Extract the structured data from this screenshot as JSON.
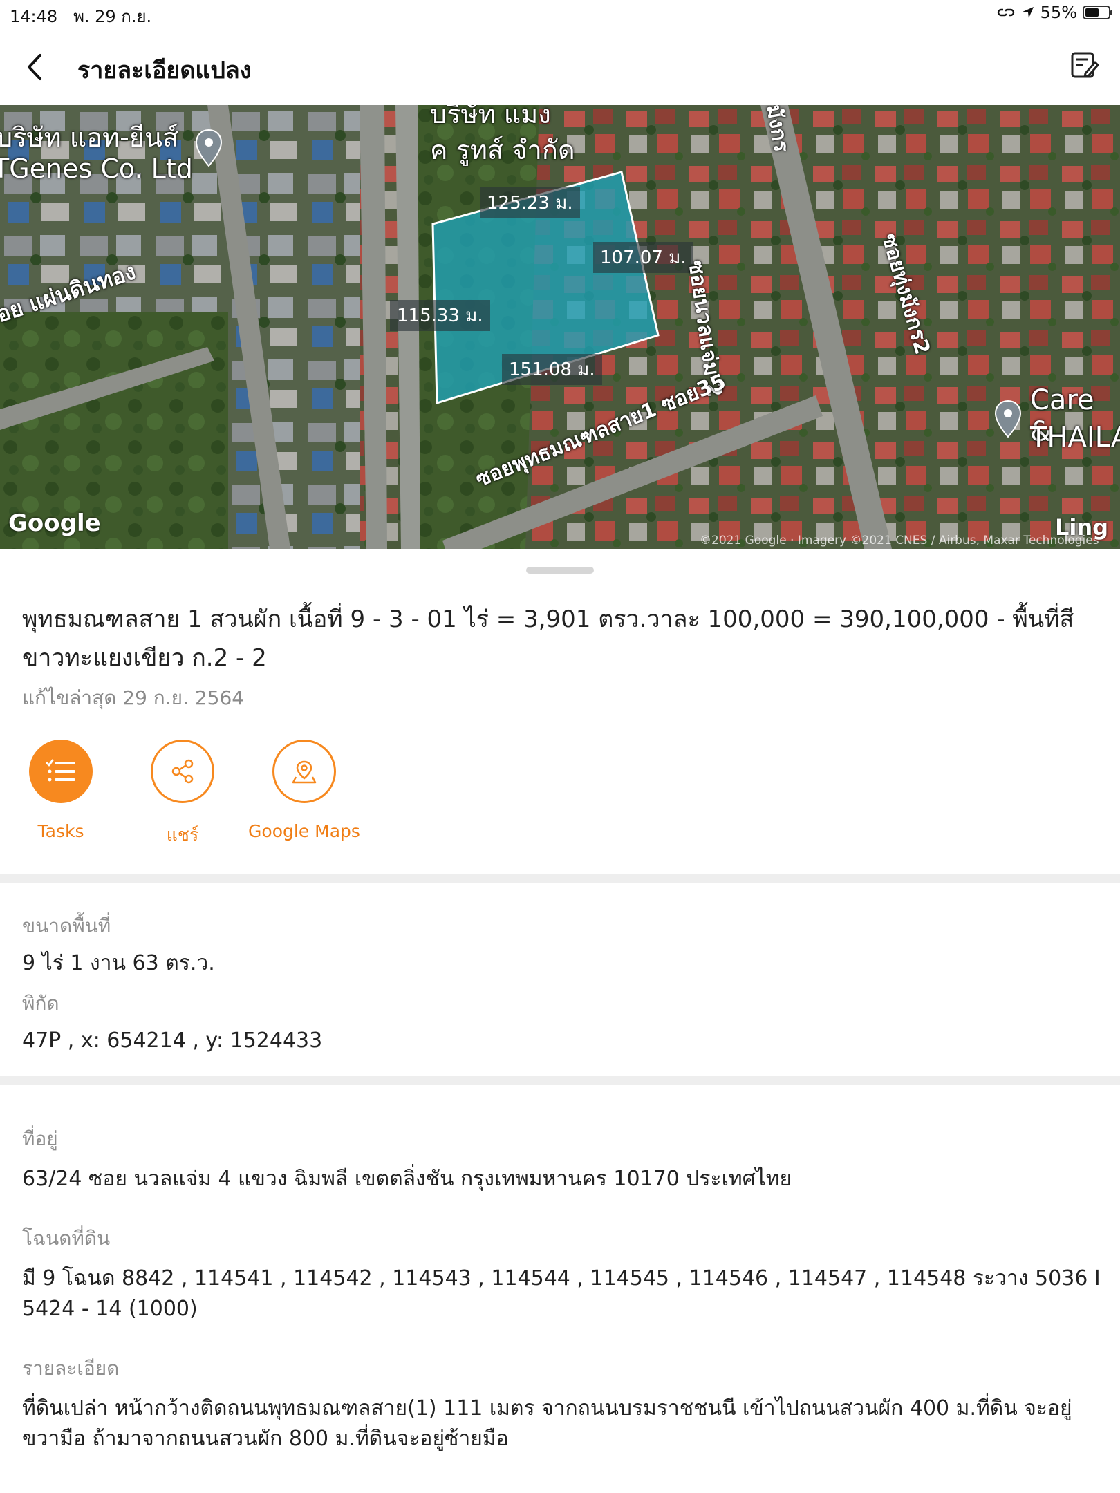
{
  "status_bar": {
    "time": "14:48",
    "date": "พ. 29 ก.ย.",
    "battery": "55%"
  },
  "header": {
    "title": "รายละเอียดแปลง",
    "back_icon": "chevron-left-icon",
    "edit_icon": "edit-note-icon"
  },
  "map": {
    "google_logo": "Google",
    "copyright": "©2021 Google · Imagery ©2021 CNES / Airbus, Maxar Technologies",
    "corner_text": "Ling",
    "measurements": [
      "125.23 ม.",
      "107.07 ม.",
      "115.33 ม.",
      "151.08 ม."
    ],
    "place_labels": [
      "บริษัท แอท-ยีนส์",
      "TGenes Co. Ltd",
      "บริษัท แมง",
      "ค รูทส์ จำกัด",
      "Care &",
      "THAILA"
    ],
    "street_labels": [
      "ซอย แผ่นดินทอง",
      "ซอยนวลแจ่ม 2",
      "ซอยทุ่งมังกร2",
      "ซอยพุทธมณฑลสาย1 ซอย35",
      "มังกร"
    ],
    "parcel_color": "#1fa3b8"
  },
  "parcel": {
    "title": "พุทธมณฑลสาย 1 สวนผัก เนื้อที่ 9 - 3 - 01 ไร่ = 3,901 ตรว.วาละ 100,000 = 390,100,000 - พื้นที่สีขาวทะแยงเขียว ก.2 - 2",
    "updated": "แก้ไขล่าสุด 29 ก.ย. 2564"
  },
  "actions": [
    {
      "label": "Tasks",
      "icon": "task-list-icon"
    },
    {
      "label": "แชร์",
      "icon": "share-icon"
    },
    {
      "label": "Google Maps",
      "icon": "map-pin-icon"
    }
  ],
  "info": {
    "area_label": "ขนาดพื้นที่",
    "area_value": "9 ไร่  1 งาน  63 ตร.ว.",
    "coord_label": "พิกัด",
    "coord_value": "47P , x: 654214 , y: 1524433",
    "address_label": "ที่อยู่",
    "address_value": "63/24 ซอย นวลแจ่ม 4 แขวง ฉิมพลี เขตตลิ่งชัน กรุงเทพมหานคร 10170 ประเทศไทย",
    "deed_label": "โฉนดที่ดิน",
    "deed_value": "มี 9 โฉนด 8842 , 114541 , 114542 , 114543 , 114544 , 114545 , 114546 , 114547 , 114548 ระวาง 5036 I 5424 - 14 (1000)",
    "detail_label": "รายละเอียด",
    "detail_value": "ที่ดินเปล่า หน้ากว้างติดถนนพุทธมณฑลสาย(1) 111 เมตร จากถนนบรมราชชนนี เข้าไปถนนสวนผัก 400 ม.ที่ดิน จะอยู่ ขวามือ ถ้ามาจากถนนสวนผัก 800 ม.ที่ดินจะอยู่ซ้ายมือ"
  },
  "colors": {
    "accent": "#f7891f",
    "text": "#222222",
    "muted": "#8e8e8e"
  }
}
